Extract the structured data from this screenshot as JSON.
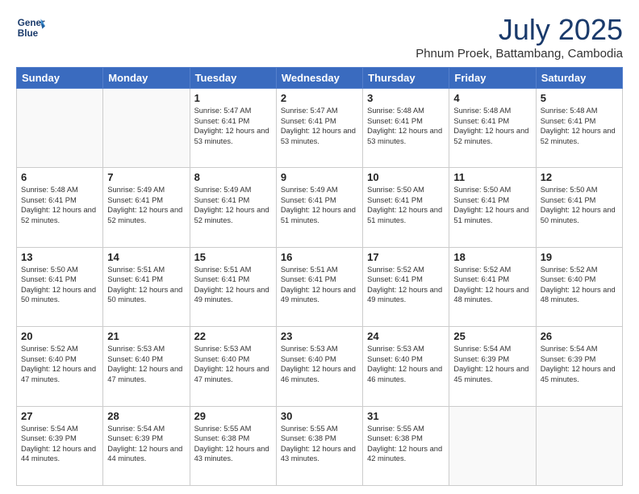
{
  "logo": {
    "line1": "General",
    "line2": "Blue"
  },
  "header": {
    "month": "July 2025",
    "location": "Phnum Proek, Battambang, Cambodia"
  },
  "weekdays": [
    "Sunday",
    "Monday",
    "Tuesday",
    "Wednesday",
    "Thursday",
    "Friday",
    "Saturday"
  ],
  "weeks": [
    [
      {
        "day": "",
        "info": ""
      },
      {
        "day": "",
        "info": ""
      },
      {
        "day": "1",
        "info": "Sunrise: 5:47 AM\nSunset: 6:41 PM\nDaylight: 12 hours and 53 minutes."
      },
      {
        "day": "2",
        "info": "Sunrise: 5:47 AM\nSunset: 6:41 PM\nDaylight: 12 hours and 53 minutes."
      },
      {
        "day": "3",
        "info": "Sunrise: 5:48 AM\nSunset: 6:41 PM\nDaylight: 12 hours and 53 minutes."
      },
      {
        "day": "4",
        "info": "Sunrise: 5:48 AM\nSunset: 6:41 PM\nDaylight: 12 hours and 52 minutes."
      },
      {
        "day": "5",
        "info": "Sunrise: 5:48 AM\nSunset: 6:41 PM\nDaylight: 12 hours and 52 minutes."
      }
    ],
    [
      {
        "day": "6",
        "info": "Sunrise: 5:48 AM\nSunset: 6:41 PM\nDaylight: 12 hours and 52 minutes."
      },
      {
        "day": "7",
        "info": "Sunrise: 5:49 AM\nSunset: 6:41 PM\nDaylight: 12 hours and 52 minutes."
      },
      {
        "day": "8",
        "info": "Sunrise: 5:49 AM\nSunset: 6:41 PM\nDaylight: 12 hours and 52 minutes."
      },
      {
        "day": "9",
        "info": "Sunrise: 5:49 AM\nSunset: 6:41 PM\nDaylight: 12 hours and 51 minutes."
      },
      {
        "day": "10",
        "info": "Sunrise: 5:50 AM\nSunset: 6:41 PM\nDaylight: 12 hours and 51 minutes."
      },
      {
        "day": "11",
        "info": "Sunrise: 5:50 AM\nSunset: 6:41 PM\nDaylight: 12 hours and 51 minutes."
      },
      {
        "day": "12",
        "info": "Sunrise: 5:50 AM\nSunset: 6:41 PM\nDaylight: 12 hours and 50 minutes."
      }
    ],
    [
      {
        "day": "13",
        "info": "Sunrise: 5:50 AM\nSunset: 6:41 PM\nDaylight: 12 hours and 50 minutes."
      },
      {
        "day": "14",
        "info": "Sunrise: 5:51 AM\nSunset: 6:41 PM\nDaylight: 12 hours and 50 minutes."
      },
      {
        "day": "15",
        "info": "Sunrise: 5:51 AM\nSunset: 6:41 PM\nDaylight: 12 hours and 49 minutes."
      },
      {
        "day": "16",
        "info": "Sunrise: 5:51 AM\nSunset: 6:41 PM\nDaylight: 12 hours and 49 minutes."
      },
      {
        "day": "17",
        "info": "Sunrise: 5:52 AM\nSunset: 6:41 PM\nDaylight: 12 hours and 49 minutes."
      },
      {
        "day": "18",
        "info": "Sunrise: 5:52 AM\nSunset: 6:41 PM\nDaylight: 12 hours and 48 minutes."
      },
      {
        "day": "19",
        "info": "Sunrise: 5:52 AM\nSunset: 6:40 PM\nDaylight: 12 hours and 48 minutes."
      }
    ],
    [
      {
        "day": "20",
        "info": "Sunrise: 5:52 AM\nSunset: 6:40 PM\nDaylight: 12 hours and 47 minutes."
      },
      {
        "day": "21",
        "info": "Sunrise: 5:53 AM\nSunset: 6:40 PM\nDaylight: 12 hours and 47 minutes."
      },
      {
        "day": "22",
        "info": "Sunrise: 5:53 AM\nSunset: 6:40 PM\nDaylight: 12 hours and 47 minutes."
      },
      {
        "day": "23",
        "info": "Sunrise: 5:53 AM\nSunset: 6:40 PM\nDaylight: 12 hours and 46 minutes."
      },
      {
        "day": "24",
        "info": "Sunrise: 5:53 AM\nSunset: 6:40 PM\nDaylight: 12 hours and 46 minutes."
      },
      {
        "day": "25",
        "info": "Sunrise: 5:54 AM\nSunset: 6:39 PM\nDaylight: 12 hours and 45 minutes."
      },
      {
        "day": "26",
        "info": "Sunrise: 5:54 AM\nSunset: 6:39 PM\nDaylight: 12 hours and 45 minutes."
      }
    ],
    [
      {
        "day": "27",
        "info": "Sunrise: 5:54 AM\nSunset: 6:39 PM\nDaylight: 12 hours and 44 minutes."
      },
      {
        "day": "28",
        "info": "Sunrise: 5:54 AM\nSunset: 6:39 PM\nDaylight: 12 hours and 44 minutes."
      },
      {
        "day": "29",
        "info": "Sunrise: 5:55 AM\nSunset: 6:38 PM\nDaylight: 12 hours and 43 minutes."
      },
      {
        "day": "30",
        "info": "Sunrise: 5:55 AM\nSunset: 6:38 PM\nDaylight: 12 hours and 43 minutes."
      },
      {
        "day": "31",
        "info": "Sunrise: 5:55 AM\nSunset: 6:38 PM\nDaylight: 12 hours and 42 minutes."
      },
      {
        "day": "",
        "info": ""
      },
      {
        "day": "",
        "info": ""
      }
    ]
  ]
}
